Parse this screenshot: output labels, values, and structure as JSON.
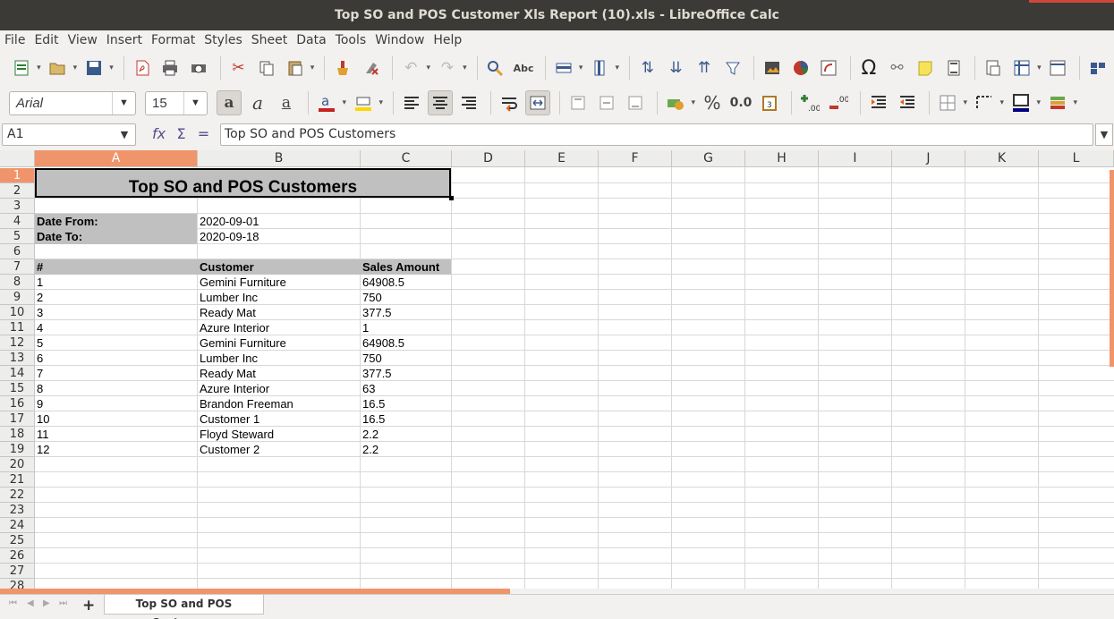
{
  "window": {
    "title": "Top SO and POS Customer Xls Report (10).xls - LibreOffice Calc"
  },
  "menu": [
    "File",
    "Edit",
    "View",
    "Insert",
    "Format",
    "Styles",
    "Sheet",
    "Data",
    "Tools",
    "Window",
    "Help"
  ],
  "toolbar": {
    "font_name": "Arial",
    "font_size": "15",
    "percent_label": "%",
    "decimal_label": "0.0"
  },
  "formula_bar": {
    "cell_ref": "A1",
    "content": "Top SO and POS Customers"
  },
  "columns": [
    "A",
    "B",
    "C",
    "D",
    "E",
    "F",
    "G",
    "H",
    "I",
    "J",
    "K",
    "L"
  ],
  "rows": [
    "1",
    "2",
    "3",
    "4",
    "5",
    "6",
    "7",
    "8",
    "9",
    "10",
    "11",
    "12",
    "13",
    "14",
    "15",
    "16",
    "17",
    "18",
    "19",
    "20",
    "21",
    "22",
    "23",
    "24",
    "25",
    "26",
    "27",
    "28"
  ],
  "sheet": {
    "title": "Top SO and POS Customers",
    "date_from_label": "Date From:",
    "date_from": "2020-09-01",
    "date_to_label": "Date To:",
    "date_to": "2020-09-18",
    "headers": [
      "#",
      "Customer",
      "Sales Amount"
    ],
    "data": [
      [
        "1",
        "Gemini Furniture",
        "64908.5"
      ],
      [
        "2",
        "Lumber Inc",
        "750"
      ],
      [
        "3",
        "Ready Mat",
        "377.5"
      ],
      [
        "4",
        "Azure Interior",
        "1"
      ],
      [
        "5",
        "Gemini Furniture",
        "64908.5"
      ],
      [
        "6",
        "Lumber Inc",
        "750"
      ],
      [
        "7",
        "Ready Mat",
        "377.5"
      ],
      [
        "8",
        "Azure Interior",
        "63"
      ],
      [
        "9",
        "Brandon Freeman",
        "16.5"
      ],
      [
        "10",
        "Customer 1",
        "16.5"
      ],
      [
        "11",
        "Floyd Steward",
        "2.2"
      ],
      [
        "12",
        "Customer 2",
        "2.2"
      ]
    ]
  },
  "tabs": {
    "active_sheet": "Top SO and POS Customers"
  },
  "colors": {
    "accent": "#f0956b",
    "header_fill": "#c0c0c0",
    "titlebar": "#3b3a36"
  }
}
